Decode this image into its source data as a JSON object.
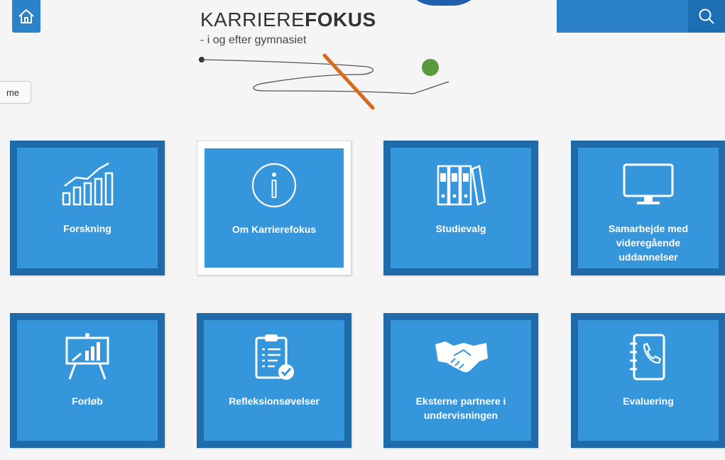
{
  "header": {
    "logo_title_light": "KARRIERE",
    "logo_title_bold": "FOKUS",
    "logo_subtitle": "- i og efter gymnasiet",
    "side_tab_label": "me"
  },
  "search": {
    "placeholder": ""
  },
  "tiles": [
    {
      "label": "Forskning",
      "icon": "bar-chart-growth-icon"
    },
    {
      "label": "Om Karrierefokus",
      "icon": "info-icon"
    },
    {
      "label": "Studievalg",
      "icon": "binders-icon"
    },
    {
      "label": "Samarbejde med videregående uddannelser",
      "icon": "monitor-icon"
    },
    {
      "label": "Forløb",
      "icon": "presentation-board-icon"
    },
    {
      "label": "Refleksionsøvelser",
      "icon": "clipboard-check-icon"
    },
    {
      "label": "Eksterne partnere i undervisningen",
      "icon": "handshake-icon"
    },
    {
      "label": "Evaluering",
      "icon": "address-book-phone-icon"
    }
  ],
  "colors": {
    "tile_outer": "#1f6aa8",
    "tile_inner": "#3696dc",
    "header_blue": "#2c82c9",
    "logo_green": "#5a9a3e",
    "logo_orange": "#d86a20"
  }
}
